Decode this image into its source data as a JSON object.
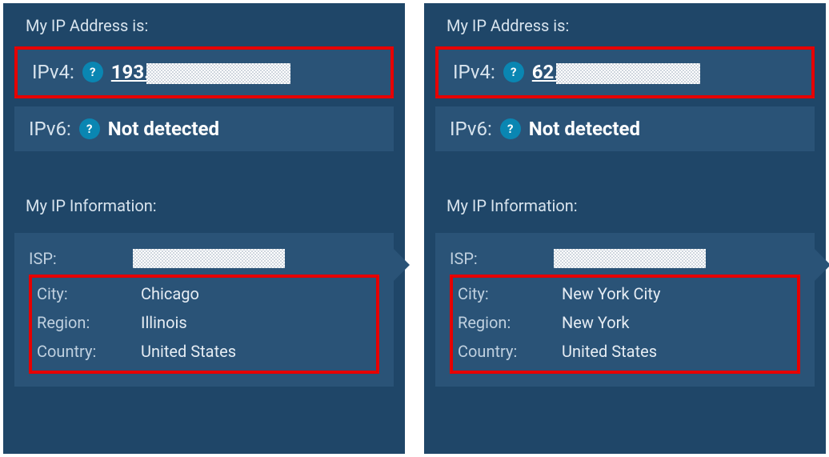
{
  "panels": [
    {
      "address_title": "My IP Address is:",
      "ipv4_label": "IPv4:",
      "ipv4_prefix": "193.",
      "help_glyph": "?",
      "ipv6_label": "IPv6:",
      "ipv6_value": "Not detected",
      "info_title": "My IP Information:",
      "isp_label": "ISP:",
      "city_label": "City:",
      "city_value": "Chicago",
      "region_label": "Region:",
      "region_value": "Illinois",
      "country_label": "Country:",
      "country_value": "United States"
    },
    {
      "address_title": "My IP Address is:",
      "ipv4_label": "IPv4:",
      "ipv4_prefix": "62.",
      "help_glyph": "?",
      "ipv6_label": "IPv6:",
      "ipv6_value": "Not detected",
      "info_title": "My IP Information:",
      "isp_label": "ISP:",
      "city_label": "City:",
      "city_value": "New York City",
      "region_label": "Region:",
      "region_value": "New York",
      "country_label": "Country:",
      "country_value": "United States"
    }
  ]
}
